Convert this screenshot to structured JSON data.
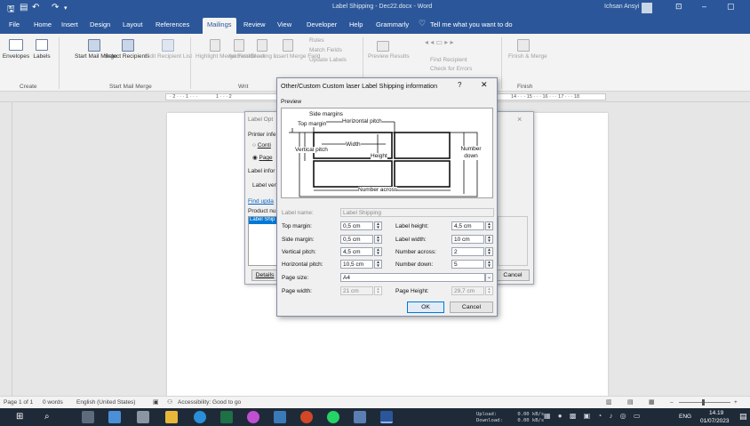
{
  "titlebar": {
    "doc_title": "Label Shipping - Dec22.docx - Word",
    "user": "Ichsan Ansyi",
    "search": "Tell me what you want to do"
  },
  "tabs": [
    "File",
    "Home",
    "Insert",
    "Design",
    "Layout",
    "References",
    "Mailings",
    "Review",
    "View",
    "Developer",
    "Help",
    "Grammarly"
  ],
  "ribbon": {
    "envelopes": "Envelopes",
    "labels": "Labels",
    "create_group": "Create",
    "start_mail_merge": "Start Mail Merge",
    "select_recipients": "Select Recipients",
    "edit_recipient_list": "Edit Recipient List",
    "start_group": "Start Mail Merge",
    "highlight": "Highlight Merge Fields",
    "address_block": "Address Block",
    "greeting": "Greeting L...",
    "insert_merge": "Insert Merge Field",
    "rules": "Rules",
    "match_fields": "Match Fields",
    "update_labels": "Update Labels",
    "write_group": "Writ",
    "preview": "Preview Results",
    "find_recipient": "Find Recipient",
    "check_errors": "Check for Errors",
    "finish": "Finish & Merge",
    "finish_group": "Finish"
  },
  "ruler": {
    "left": "· 2 · · · 1 · · ·",
    "mid": "1 · · · 2",
    "right": "14 · · · 15 · · · 16 · · · 17 · · · 18"
  },
  "bg_dialog": {
    "title": "Label Opt",
    "printer_info": "Printer infe",
    "opt_continuous": "Conti",
    "opt_page": "Page",
    "label_info": "Label infor",
    "label_vendor": "Label ven",
    "find_updates": "Find upda",
    "product_number": "Product nu",
    "product_item": "Label Ship",
    "details": "Details",
    "cancel": "Cancel"
  },
  "dialog": {
    "title": "Other/Custom Custom laser Label Shipping information",
    "help": "?",
    "preview_label": "Preview",
    "preview": {
      "side_margins": "Side margins",
      "top_margin": "Top margin",
      "horizontal_pitch": "Horizontal pitch",
      "vertical_pitch": "Vertical pitch",
      "width": "Width",
      "height": "Height",
      "number_down": "Number down",
      "number_across": "Number across"
    },
    "fields": {
      "label_name_label": "Label name:",
      "label_name": "Label Shipping",
      "top_margin_label": "Top margin:",
      "top_margin": "0,5 cm",
      "label_height_label": "Label height:",
      "label_height": "4,5 cm",
      "side_margin_label": "Side margin:",
      "side_margin": "0,5 cm",
      "label_width_label": "Label width:",
      "label_width": "10 cm",
      "vertical_pitch_label": "Vertical pitch:",
      "vertical_pitch": "4,5 cm",
      "number_across_label": "Number across:",
      "number_across": "2",
      "horizontal_pitch_label": "Horizontal pitch:",
      "horizontal_pitch": "10,5 cm",
      "number_down_label": "Number down:",
      "number_down": "5",
      "page_size_label": "Page size:",
      "page_size": "A4",
      "page_width_label": "Page width:",
      "page_width": "21 cm",
      "page_height_label": "Page Height:",
      "page_height": "29,7 cm"
    },
    "ok": "OK",
    "cancel": "Cancel"
  },
  "status": {
    "page": "Page 1 of 1",
    "words": "0 words",
    "lang": "English (United States)",
    "accessibility": "Accessibility: Good to go"
  },
  "taskbar": {
    "upload": "Upload:       0.00 kB/s",
    "download": "Download:     0.00 kB/s",
    "lang": "ENG",
    "time": "14.19",
    "date": "01/07/2023"
  }
}
